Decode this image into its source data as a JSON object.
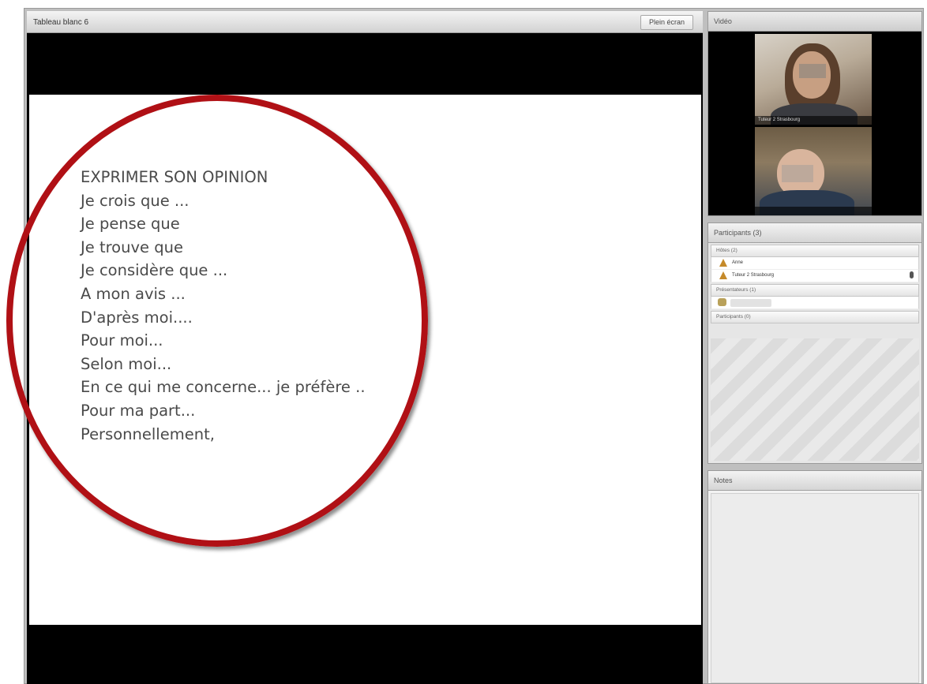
{
  "whiteboard": {
    "title": "Tableau blanc 6",
    "fullscreen_label": "Plein écran",
    "lines": [
      "EXPRIMER SON OPINION",
      "Je crois que ...",
      "Je pense que",
      "Je trouve que",
      "Je considère que ...",
      "A mon avis ...",
      "D'après moi....",
      "Pour moi...",
      "Selon moi...",
      "En ce qui me concerne... je préfère ..",
      "Pour ma part...",
      "Personnellement,"
    ]
  },
  "video": {
    "title": "Vidéo",
    "cam1_label": "Tuteur 2 Strasbourg",
    "cam2_label": ""
  },
  "participants": {
    "title": "Participants (3)",
    "hosts_header": "Hôtes (2)",
    "hosts": [
      "Anne",
      "Tuteur 2 Strasbourg"
    ],
    "presenters_header": "Présentateurs (1)",
    "participants_header": "Participants (0)"
  },
  "notes": {
    "title": "Notes"
  },
  "colors": {
    "highlight_circle": "#b01015"
  }
}
